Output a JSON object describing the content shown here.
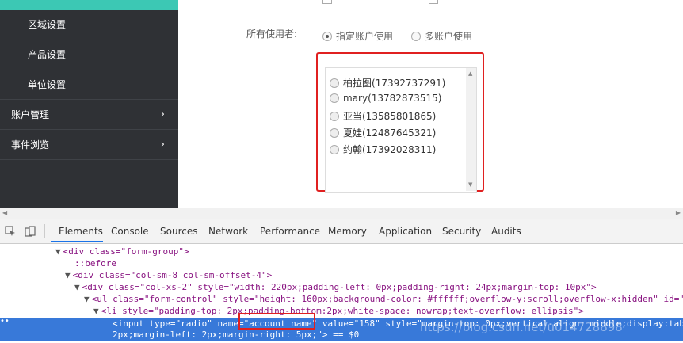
{
  "sidebar": {
    "sub_items": [
      {
        "label": "区域设置"
      },
      {
        "label": "产品设置"
      },
      {
        "label": "单位设置"
      }
    ],
    "main_items": [
      {
        "label": "账户管理",
        "chevron": "›"
      },
      {
        "label": "事件浏览",
        "chevron": "›"
      }
    ]
  },
  "form": {
    "owner_label": "所有使用者:",
    "owner_options": [
      {
        "label": "指定账户使用",
        "checked": true
      },
      {
        "label": "多账户使用",
        "checked": false
      }
    ],
    "accounts": [
      {
        "label": "柏拉图(17392737291)"
      },
      {
        "label": "mary(13782873515)"
      },
      {
        "label": "亚当(13585801865)"
      },
      {
        "label": "夏娃(12487645321)"
      },
      {
        "label": "约翰(17392028311)"
      }
    ]
  },
  "devtools": {
    "tabs": [
      "Elements",
      "Console",
      "Sources",
      "Network",
      "Performance",
      "Memory",
      "Application",
      "Security",
      "Audits"
    ],
    "active_tab": "Elements",
    "code_lines": [
      "<div class=\"form-group\">",
      "::before",
      "<div class=\"col-sm-8 col-sm-offset-4\">",
      "<div class=\"col-xs-2\" style=\"width: 220px;padding-left: 0px;padding-right: 24px;margin-top: 10px\">",
      "<ul class=\"form-control\" style=\"height: 160px;background-color: #ffffff;overflow-y:scroll;overflow-x:hidden\" id=\"",
      "<li style=\"padding-top: 2px;padding-bottom:2px;white-space: nowrap;text-overflow: ellipsis\">"
    ],
    "selected_line_1": "<input type=\"radio\" name=\"account_name\" value=\"158\" style=\"margin-top: 0px;vertical-align: middle;display:tab",
    "selected_line_2": "2px;margin-left: 2px;margin-right: 5px;\"> == $0",
    "watermark": "https://blog.csdn.net/u014728898"
  }
}
